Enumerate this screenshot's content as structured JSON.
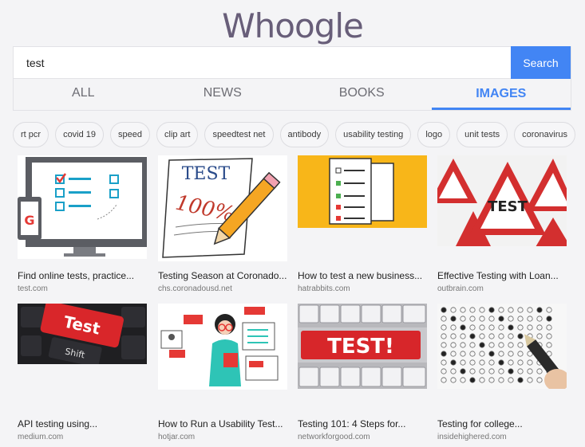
{
  "logo": "Whoogle",
  "search": {
    "value": "test",
    "button": "Search"
  },
  "tabs": [
    {
      "label": "ALL",
      "active": false
    },
    {
      "label": "NEWS",
      "active": false
    },
    {
      "label": "BOOKS",
      "active": false
    },
    {
      "label": "IMAGES",
      "active": true
    }
  ],
  "chips": [
    "rt pcr",
    "covid 19",
    "speed",
    "clip art",
    "speedtest net",
    "antibody",
    "usability testing",
    "logo",
    "unit tests",
    "coronavirus"
  ],
  "results": [
    {
      "title": "Find online tests, practice...",
      "source": "test.com",
      "thumb": {
        "icon": "monitor-checklist-image",
        "letter": "G"
      }
    },
    {
      "title": "Testing Season at Coronado...",
      "source": "chs.coronadousd.net",
      "thumb": {
        "icon": "test-paper-pencil-image",
        "word": "TEST",
        "score": "100%"
      }
    },
    {
      "title": "How to test a new business...",
      "source": "hatrabbits.com",
      "thumb": {
        "icon": "checklist-clipboard-image"
      }
    },
    {
      "title": "Effective Testing with Loan...",
      "source": "outbrain.com",
      "thumb": {
        "icon": "test-warning-signs-image",
        "word": "TEST"
      }
    },
    {
      "title": "API testing using...",
      "source": "medium.com",
      "thumb": {
        "icon": "keyboard-test-key-image",
        "word": "Test",
        "key": "Shift"
      }
    },
    {
      "title": "How to Run a Usability Test...",
      "source": "hotjar.com",
      "thumb": {
        "icon": "usability-person-image"
      }
    },
    {
      "title": "Testing 101: 4 Steps for...",
      "source": "networkforgood.com",
      "thumb": {
        "icon": "keyboard-test-letters-image",
        "word": "TEST!"
      }
    },
    {
      "title": "Testing for college...",
      "source": "insidehighered.com",
      "thumb": {
        "icon": "bubble-sheet-image"
      }
    }
  ]
}
